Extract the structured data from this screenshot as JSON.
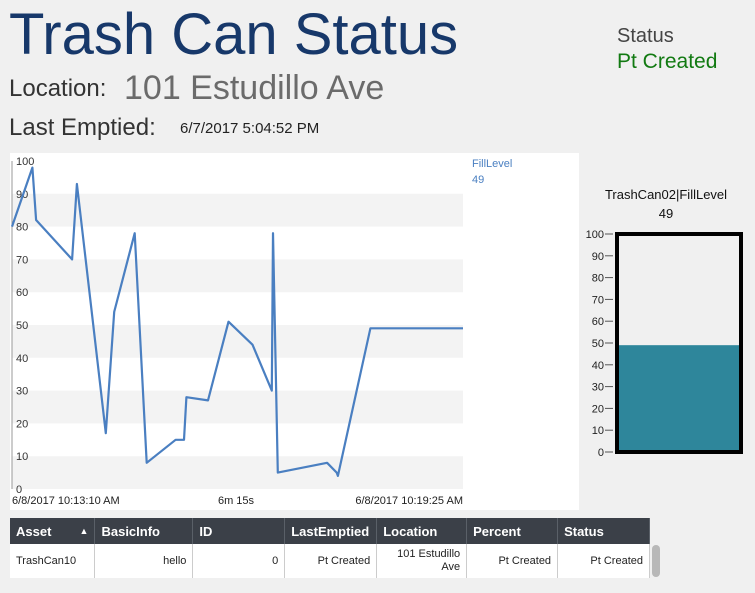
{
  "header": {
    "title": "Trash Can Status",
    "location_label": "Location:",
    "location_value": "101 Estudillo Ave",
    "emptied_label": "Last Emptied:",
    "emptied_value": "6/7/2017 5:04:52 PM",
    "status_label": "Status",
    "status_value": "Pt Created"
  },
  "colors": {
    "title": "#17386a",
    "status_ok": "#127a12",
    "trend_line": "#4a7fc1",
    "gauge_fill": "#2e869b"
  },
  "chart_data": [
    {
      "type": "line",
      "title": "",
      "xlabel": "",
      "ylabel": "",
      "x_tick_labels": [
        "6/8/2017 10:13:10 AM",
        "6m 15s",
        "6/8/2017 10:19:25 AM"
      ],
      "ylim": [
        0,
        100
      ],
      "y_ticks": [
        0,
        10,
        20,
        30,
        40,
        50,
        60,
        70,
        80,
        90,
        100
      ],
      "grid": "horizontal-bands",
      "legend": "top-right",
      "series": [
        {
          "name": "FillLevel",
          "current_value": "49",
          "x_seconds": [
            0,
            17,
            20,
            50,
            54,
            78,
            85,
            102,
            112,
            136,
            143,
            145,
            163,
            180,
            200,
            216,
            217,
            221,
            262,
            270,
            271,
            298,
            375
          ],
          "values": [
            80,
            98,
            82,
            70,
            93,
            17,
            54,
            78,
            8,
            15,
            15,
            28,
            27,
            51,
            44,
            30,
            78,
            5,
            8,
            5,
            4,
            49,
            49
          ]
        }
      ]
    },
    {
      "type": "bar",
      "title": "TrashCan02|FillLevel",
      "value_label": "49",
      "values": [
        49
      ],
      "ylim": [
        0,
        100
      ],
      "y_ticks": [
        0,
        10,
        20,
        30,
        40,
        50,
        60,
        70,
        80,
        90,
        100
      ]
    }
  ],
  "table": {
    "columns": [
      "Asset",
      "BasicInfo",
      "ID",
      "LastEmptied",
      "Location",
      "Percent",
      "Status"
    ],
    "sort_indicator": "▲",
    "rows": [
      [
        "TrashCan10",
        "hello",
        "0",
        "Pt Created",
        "101 Estudillo Ave",
        "Pt Created",
        "Pt Created"
      ]
    ]
  }
}
